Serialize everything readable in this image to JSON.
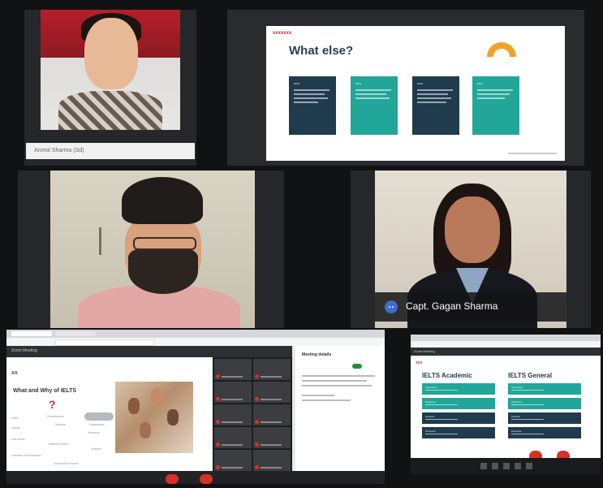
{
  "tiles": {
    "participant1": {
      "name": "Anmol Sharma (Sd)"
    },
    "slide": {
      "brand": "xxxxxxx",
      "title": "What else?",
      "cards": [
        {
          "label": "xx:x",
          "color": "#1f3b4d"
        },
        {
          "label": "xx:x",
          "color": "#22a699"
        },
        {
          "label": "xx:x",
          "color": "#1f3b4d"
        },
        {
          "label": "xx:x",
          "color": "#22a699"
        }
      ],
      "colors": {
        "navy": "#1f3b4d",
        "teal": "#22a699",
        "accent": "#f0a32b"
      }
    },
    "participant4": {
      "name": "Capt. Gagan Sharma",
      "avatar_icon": "avatar-dots-icon",
      "avatar_color": "#3f6dcf"
    },
    "meeting": {
      "window_title": "Zoom Meeting",
      "share": {
        "brand": "xx",
        "question": "What and Why of IELTS",
        "question_mark": "?",
        "chips": [
          "Xxxx",
          "Xxxxxxxxxx",
          "Xxxxxx",
          "Xxxxx",
          "Xxxxxxxxx",
          "Xxxxxxx",
          "Xxx Xxxx",
          "Xxxxxx Xxxxx",
          "Xxxxxx",
          "Xxxxxxx Xxxxxxxxxx",
          "Xxxxxxxxx Xxxxx"
        ]
      },
      "panel": {
        "title": "Meeting details"
      },
      "end_color": "#d93025"
    },
    "ielts": {
      "brand": "xxx",
      "academic_title": "IELTS Academic",
      "general_title": "IELTS General",
      "academic": [
        "Xxxxxxxxx",
        "Xxxxxxxx",
        "Xxxxxxx",
        "Xxxxxxxx"
      ],
      "general": [
        "Xxxxxxxxx",
        "Xxxxxxxx",
        "Xxxxxxx",
        "Xxxxxxxx"
      ],
      "colors": {
        "navy": "#1f3b4d",
        "teal": "#22a699"
      }
    }
  }
}
